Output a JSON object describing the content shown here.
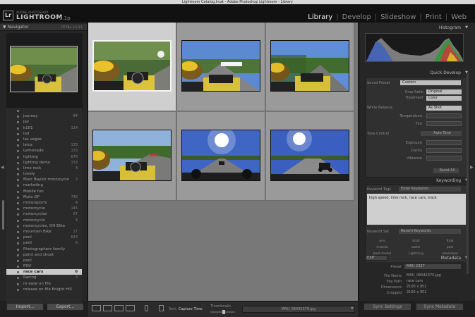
{
  "titlebar": {
    "title": "Lightroom Catalog.lrcat - Adobe Photoshop Lightroom - Library"
  },
  "identity": {
    "badge": "Lr",
    "brand_top": "ADOBE PHOTOSHOP",
    "brand_name": "LIGHTROOM",
    "version": "1.1p",
    "modules": [
      "Library",
      "Develop",
      "Slideshow",
      "Print",
      "Web"
    ],
    "active_module": "Library"
  },
  "navigator": {
    "title": "Navigator",
    "zoom_options": "FIT  FILL  1:1  3:1"
  },
  "keywords": [
    {
      "name": "",
      "count": ""
    },
    {
      "name": "journey",
      "count": "84"
    },
    {
      "name": "jay",
      "count": ""
    },
    {
      "name": "k101",
      "count": "124"
    },
    {
      "name": "lad",
      "count": ""
    },
    {
      "name": "las vegas",
      "count": ""
    },
    {
      "name": "leica",
      "count": "133"
    },
    {
      "name": "Lemonade",
      "count": "133"
    },
    {
      "name": "lighting",
      "count": "676"
    },
    {
      "name": "lighting demo",
      "count": "133"
    },
    {
      "name": "lime rock",
      "count": "4"
    },
    {
      "name": "lonely",
      "count": ""
    },
    {
      "name": "Marc Baylor motorcycle",
      "count": "2"
    },
    {
      "name": "marketing",
      "count": ""
    },
    {
      "name": "Mobile fun",
      "count": ""
    },
    {
      "name": "Moto GP",
      "count": "736"
    },
    {
      "name": "motorsports",
      "count": "4"
    },
    {
      "name": "motorcycle",
      "count": "145"
    },
    {
      "name": "motorcycles",
      "count": "67"
    },
    {
      "name": "motorcycle",
      "count": "4"
    },
    {
      "name": "motorcycles, DH Elite",
      "count": ""
    },
    {
      "name": "mountain Bike",
      "count": "17"
    },
    {
      "name": "pool",
      "count": "643"
    },
    {
      "name": "pedl",
      "count": "8"
    },
    {
      "name": "Photographers family",
      "count": ""
    },
    {
      "name": "point and shoot",
      "count": ""
    },
    {
      "name": "pool",
      "count": ""
    },
    {
      "name": "POV",
      "count": ""
    },
    {
      "name": "race cars",
      "count": "6"
    },
    {
      "name": "Racing",
      "count": "3"
    },
    {
      "name": "re ease on file",
      "count": ""
    },
    {
      "name": "release on file Knight Hill",
      "count": ""
    }
  ],
  "selected_keyword": "race cars",
  "left_buttons": {
    "import": "Import...",
    "export": "Export..."
  },
  "grid": {
    "photos": [
      {
        "name": "photo-1",
        "selected": true
      },
      {
        "name": "photo-2",
        "selected": false
      },
      {
        "name": "photo-3",
        "selected": false
      },
      {
        "name": "photo-4",
        "selected": false
      },
      {
        "name": "photo-5",
        "selected": false
      },
      {
        "name": "photo-6",
        "selected": false
      }
    ]
  },
  "right_panel": {
    "histogram_title": "Histogram",
    "quick_develop_title": "Quick Develop",
    "saved_preset_label": "Saved Preset",
    "saved_preset_value": "Custom",
    "crop_ratio_label": "Crop Ratio",
    "crop_ratio_value": "Original",
    "treatment_label": "Treatment",
    "treatment_value": "Color",
    "white_balance_label": "White Balance",
    "white_balance_value": "As Shot",
    "temperature_label": "Temperature",
    "tint_label": "Tint",
    "tone_control_label": "Tone Control",
    "auto_tone_label": "Auto Tone",
    "exposure_label": "Exposure",
    "clarity_label": "Clarity",
    "vibrance_label": "Vibrance",
    "reset_all_label": "Reset All",
    "keywording_title": "Keywording",
    "keyword_tags_label": "Keyword Tags",
    "keyword_tags_value": "Enter Keywords",
    "keyword_text": "high speed, lime rock, race cars, track",
    "keyword_set_label": "Keyword Set",
    "keyword_set_value": "Recent Keywords",
    "suggestions": [
      "pov",
      "boat",
      "Italy",
      "Aranda",
      "water",
      "pool",
      "boot model",
      "Lightning",
      "adventure"
    ],
    "metadata_title": "Metadata",
    "exif_label": "EXIF",
    "preset_label": "Preset",
    "preset_value": "MRU 2337",
    "file_name_label": "File Name",
    "file_name_value": "MRU_06042370.jpg",
    "file_path_label": "File Path",
    "file_path_value": "race cars",
    "dimensions_label": "Dimensions",
    "dimensions_value": "2100 x 952",
    "cropped_label": "Cropped",
    "cropped_value": "2100 x 952",
    "sync_settings": "Sync Settings",
    "sync_metadata": "Sync Metadata"
  },
  "toolbar": {
    "sort_label": "Sort:",
    "sort_value": "Capture Time",
    "thumbnails_label": "Thumbnails",
    "thumbnail_size": 0.55,
    "filename": "MRU_06042370.jpg"
  },
  "colors": {
    "grid_bg": "#787878",
    "cell_bg": "#9a9a9a",
    "cell_selected": "#cfcfcf",
    "panel_bg": "#262626",
    "active_module": "#f0f0f0"
  }
}
